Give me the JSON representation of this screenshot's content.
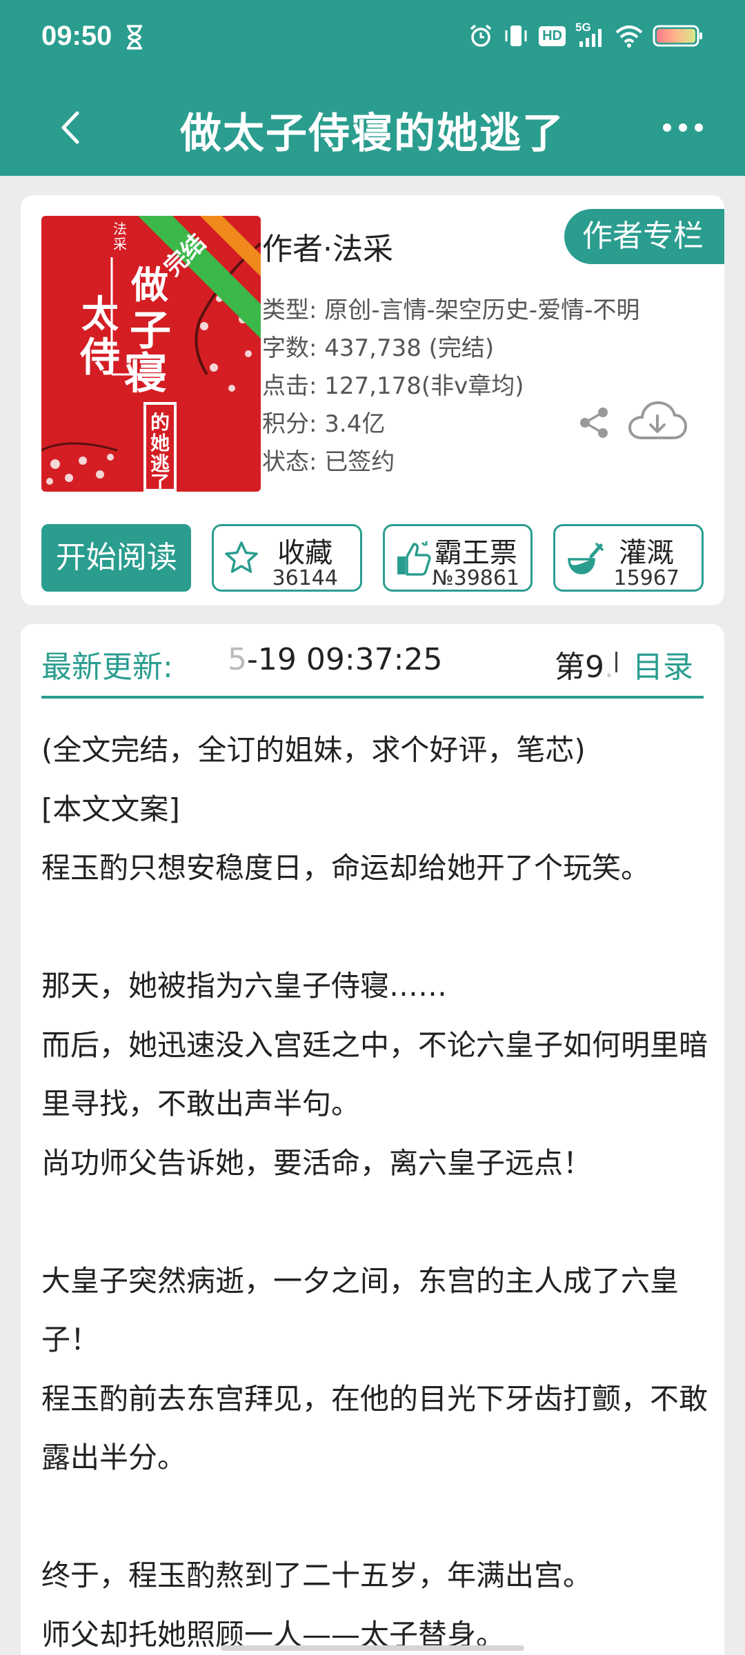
{
  "status": {
    "time": "09:50",
    "hd_label": "HD",
    "network_label": "5G"
  },
  "header": {
    "title": "做太子侍寝的她逃了"
  },
  "book": {
    "cover_author_tag": "法采",
    "cover_badge": "完结",
    "cover_title_chars": [
      "做",
      "太",
      "子",
      "侍",
      "寝"
    ],
    "cover_subtitle": [
      "的",
      "她",
      "逃",
      "了"
    ],
    "author": "作者·法采",
    "author_column_label": "作者专栏",
    "genre": "类型: 原创-言情-架空历史-爱情-不明",
    "word_count": "字数: 437,738 (完结)",
    "clicks": "点击: 127,178(非v章均)",
    "score": "积分: 3.4亿",
    "status": "状态: 已签约"
  },
  "actions": {
    "start_read_label": "开始阅读",
    "favorite_label": "收藏",
    "favorite_count": "36144",
    "ticket_label": "霸王票",
    "ticket_count": "№39861",
    "water_label": "灌溉",
    "water_count": "15967"
  },
  "update": {
    "label": "最新更新:",
    "time_faded": "5",
    "time": "-19 09:37:25",
    "chapter": "第9",
    "chapter_faded": ".",
    "toc_label": "目录"
  },
  "synopsis": {
    "lines": [
      "(全文完结，全订的姐妹，求个好评，笔芯)",
      "[本文文案]",
      "程玉酌只想安稳度日，命运却给她开了个玩笑。",
      "",
      "那天，她被指为六皇子侍寝……",
      "而后，她迅速没入宫廷之中，不论六皇子如何明里暗里寻找，不敢出声半句。",
      "尚功师父告诉她，要活命，离六皇子远点！",
      "",
      "大皇子突然病逝，一夕之间，东宫的主人成了六皇子！",
      "程玉酌前去东宫拜见，在他的目光下牙齿打颤，不敢露出半分。",
      "",
      "终于，程玉酌熬到了二十五岁，年满出宫。",
      "师父却托她照顾一人——太子替身。"
    ]
  },
  "colors": {
    "accent": "#2a9d8f",
    "cover_red": "#d41e24",
    "badge_green": "#3cb84a",
    "badge_orange": "#f08a1c"
  }
}
